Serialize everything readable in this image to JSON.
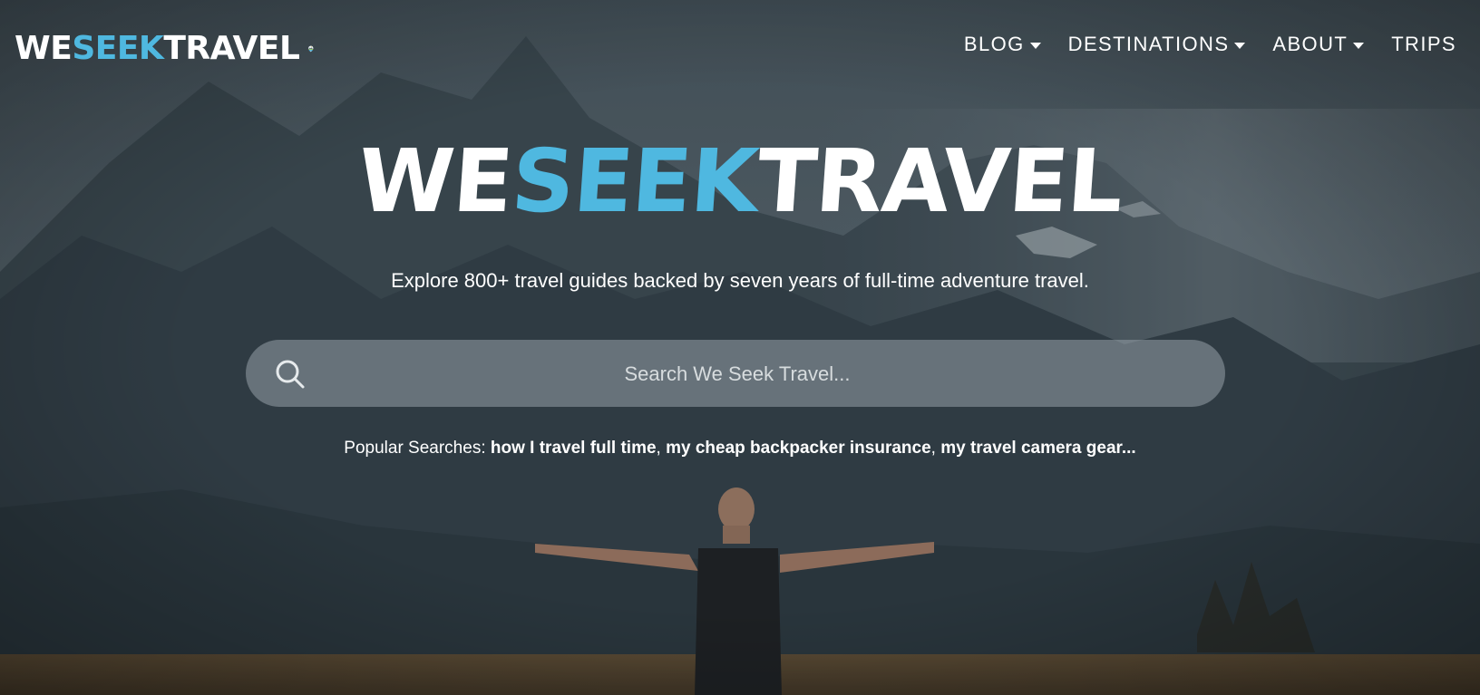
{
  "header": {
    "logo": {
      "we": "WE",
      "seek": "SEEK",
      "travel": "TRAVEL"
    },
    "nav": [
      {
        "label": "BLOG",
        "has_dropdown": true
      },
      {
        "label": "DESTINATIONS",
        "has_dropdown": true
      },
      {
        "label": "ABOUT",
        "has_dropdown": true
      },
      {
        "label": "TRIPS",
        "has_dropdown": false
      }
    ]
  },
  "hero": {
    "wordmark": {
      "we": "WE",
      "seek": "SEEK",
      "travel": "TRAVEL"
    },
    "tagline": "Explore 800+ travel guides backed by seven years of full-time adventure travel.",
    "search": {
      "placeholder": "Search We Seek Travel...",
      "value": ""
    },
    "popular": {
      "label": "Popular Searches:",
      "links": [
        "how I travel full time",
        "my cheap backpacker insurance",
        "my travel camera gear..."
      ]
    }
  },
  "colors": {
    "accent_blue": "#4fb8e0",
    "text": "#ffffff",
    "overlay": "#2b3640"
  },
  "icons": [
    "search-icon",
    "caret-down-icon",
    "location-pin-logo-icon"
  ]
}
